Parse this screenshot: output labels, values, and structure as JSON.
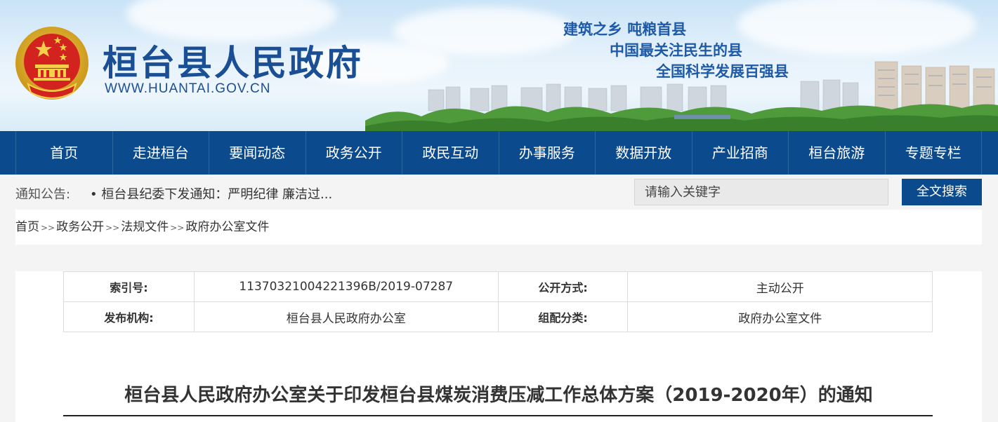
{
  "header": {
    "site_title": "桓台县人民政府",
    "site_url": "WWW.HUANTAI.GOV.CN",
    "slogans": [
      "建筑之乡 吨粮首县",
      "中国最关注民生的县",
      "全国科学发展百强县"
    ],
    "emblem_icon": "national-emblem-icon",
    "colors": {
      "title": "#1a4f95",
      "nav": "#0c4a8e"
    }
  },
  "nav": {
    "items": [
      "首页",
      "走进桓台",
      "要闻动态",
      "政务公开",
      "政民互动",
      "办事服务",
      "数据开放",
      "产业招商",
      "桓台旅游",
      "专题专栏"
    ]
  },
  "notice": {
    "label": "通知公告:",
    "text": "• 桓台县纪委下发通知：严明纪律 廉洁过..."
  },
  "search": {
    "placeholder": "请输入关键字",
    "button": "全文搜索"
  },
  "breadcrumb": {
    "items": [
      "首页",
      "政务公开",
      "法规文件",
      "政府办公室文件"
    ],
    "separator": ">>"
  },
  "meta": {
    "index_label": "索引号:",
    "index_value": "11370321004221396B/2019-07287",
    "open_label": "公开方式:",
    "open_value": "主动公开",
    "org_label": "发布机构:",
    "org_value": "桓台县人民政府办公室",
    "category_label": "组配分类:",
    "category_value": "政府办公室文件"
  },
  "document": {
    "title": "桓台县人民政府办公室关于印发桓台县煤炭消费压减工作总体方案（2019-2020年）的通知"
  }
}
